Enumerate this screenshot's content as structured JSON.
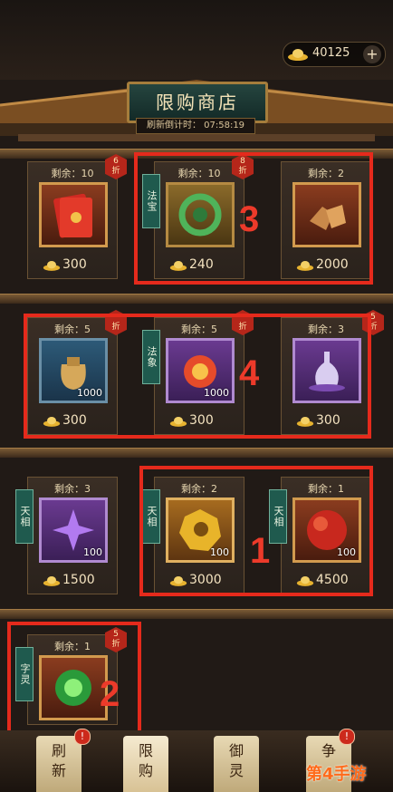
{
  "header": {
    "currency_amount": "40125",
    "add_label": "+",
    "title": "限购商店",
    "countdown": "刷新倒计时： 07:58:19"
  },
  "shop_rows": [
    {
      "items": [
        {
          "remain": "剩余：10",
          "price": "300",
          "discount": "6\n折",
          "qty": "",
          "icon": "red-envelope-icon",
          "tag": ""
        },
        {
          "remain": "剩余：10",
          "price": "240",
          "discount": "8\n折",
          "qty": "",
          "icon": "jade-dragon-icon",
          "tag": "法宝"
        },
        {
          "remain": "剩余：2",
          "price": "2000",
          "discount": "",
          "qty": "",
          "icon": "ore-chunks-icon",
          "tag": ""
        }
      ]
    },
    {
      "items": [
        {
          "remain": "剩余：5",
          "price": "300",
          "discount": "\n折",
          "qty": "1000",
          "icon": "coin-bag-icon",
          "tag": ""
        },
        {
          "remain": "剩余：5",
          "price": "300",
          "discount": "\n折",
          "qty": "1000",
          "icon": "flame-orb-icon",
          "tag": "法象"
        },
        {
          "remain": "剩余：3",
          "price": "300",
          "discount": "5\n折",
          "qty": "",
          "icon": "purple-vase-icon",
          "tag": ""
        }
      ]
    },
    {
      "items": [
        {
          "remain": "剩余：3",
          "price": "1500",
          "discount": "",
          "qty": "100",
          "icon": "purple-star-icon",
          "tag": "天相"
        },
        {
          "remain": "剩余：2",
          "price": "3000",
          "discount": "",
          "qty": "100",
          "icon": "gold-moon-icon",
          "tag": "天相"
        },
        {
          "remain": "剩余：1",
          "price": "4500",
          "discount": "",
          "qty": "100",
          "icon": "blood-moon-icon",
          "tag": "天相"
        }
      ]
    },
    {
      "items": [
        {
          "remain": "剩余：1",
          "price": "",
          "discount": "5\n折",
          "qty": "",
          "icon": "green-jade-icon",
          "tag": "字灵"
        }
      ]
    }
  ],
  "annotations": [
    "3",
    "4",
    "1",
    "2"
  ],
  "nav": [
    {
      "label": "刷\n新",
      "active": false,
      "alert": "!"
    },
    {
      "label": "限\n购",
      "active": true,
      "alert": ""
    },
    {
      "label": "御\n灵",
      "active": false,
      "alert": ""
    },
    {
      "label": "争",
      "active": false,
      "alert": "!"
    }
  ],
  "watermark": "第4手游",
  "colors": {
    "highlight": "#e52a1c",
    "discount_badge": "#b5261a",
    "tag_bg": "#1f5a4e"
  }
}
